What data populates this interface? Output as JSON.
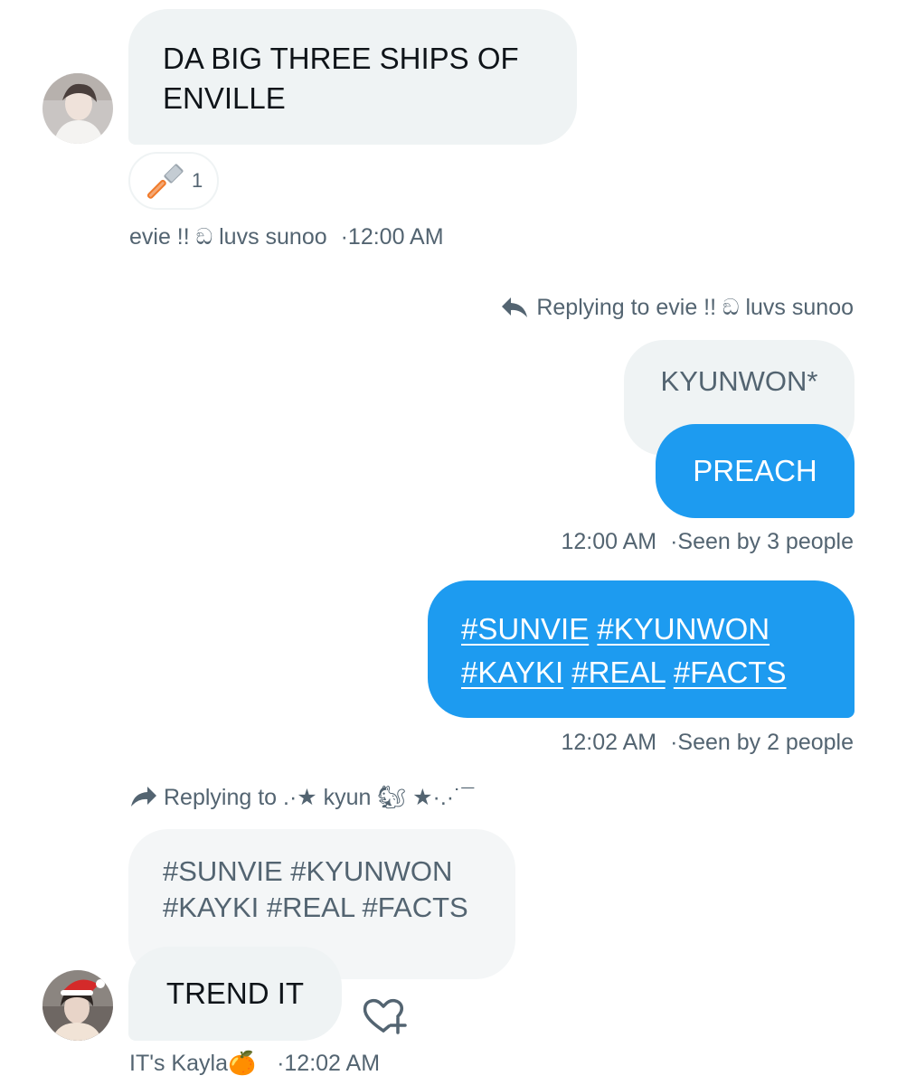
{
  "message_1": {
    "text_line_1": "DA BIG THREE SHIPS OF",
    "text_line_2": "ENVILLE",
    "reaction_count": "1",
    "sender": "evie !! ඞ luvs sunoo",
    "sep": "·",
    "time": "12:00 AM"
  },
  "reply_1": {
    "replying_label": "Replying to evie !! ඞ luvs sunoo",
    "quoted_text": "KYUNWON*",
    "text": "PREACH",
    "time": "12:00 AM",
    "sep": "·",
    "seen": "Seen by 3 people"
  },
  "message_3": {
    "tags_line_1": [
      "#SUNVIE",
      "#KYUNWON"
    ],
    "tags_line_2": [
      "#KAYKI",
      "#REAL",
      "#FACTS"
    ],
    "time": "12:02 AM",
    "sep": "·",
    "seen": "Seen by 2 people"
  },
  "reply_2": {
    "replying_label": "Replying to .·★ kyun 🐿 ★·.·˙¯",
    "quoted_line_1": "#SUNVIE #KYUNWON",
    "quoted_line_2": "#KAYKI #REAL #FACTS",
    "text": "TREND IT",
    "sender": "IT's Kayla🍊",
    "sep": "·",
    "time": "12:02 AM"
  },
  "colors": {
    "blue": "#1d9bf0",
    "bubble_gray": "#eff3f4",
    "meta_gray": "#536471"
  },
  "icons": [
    "razor-icon",
    "reply-arrow-icon",
    "forward-arrow-icon",
    "add-reaction-heart-icon"
  ]
}
